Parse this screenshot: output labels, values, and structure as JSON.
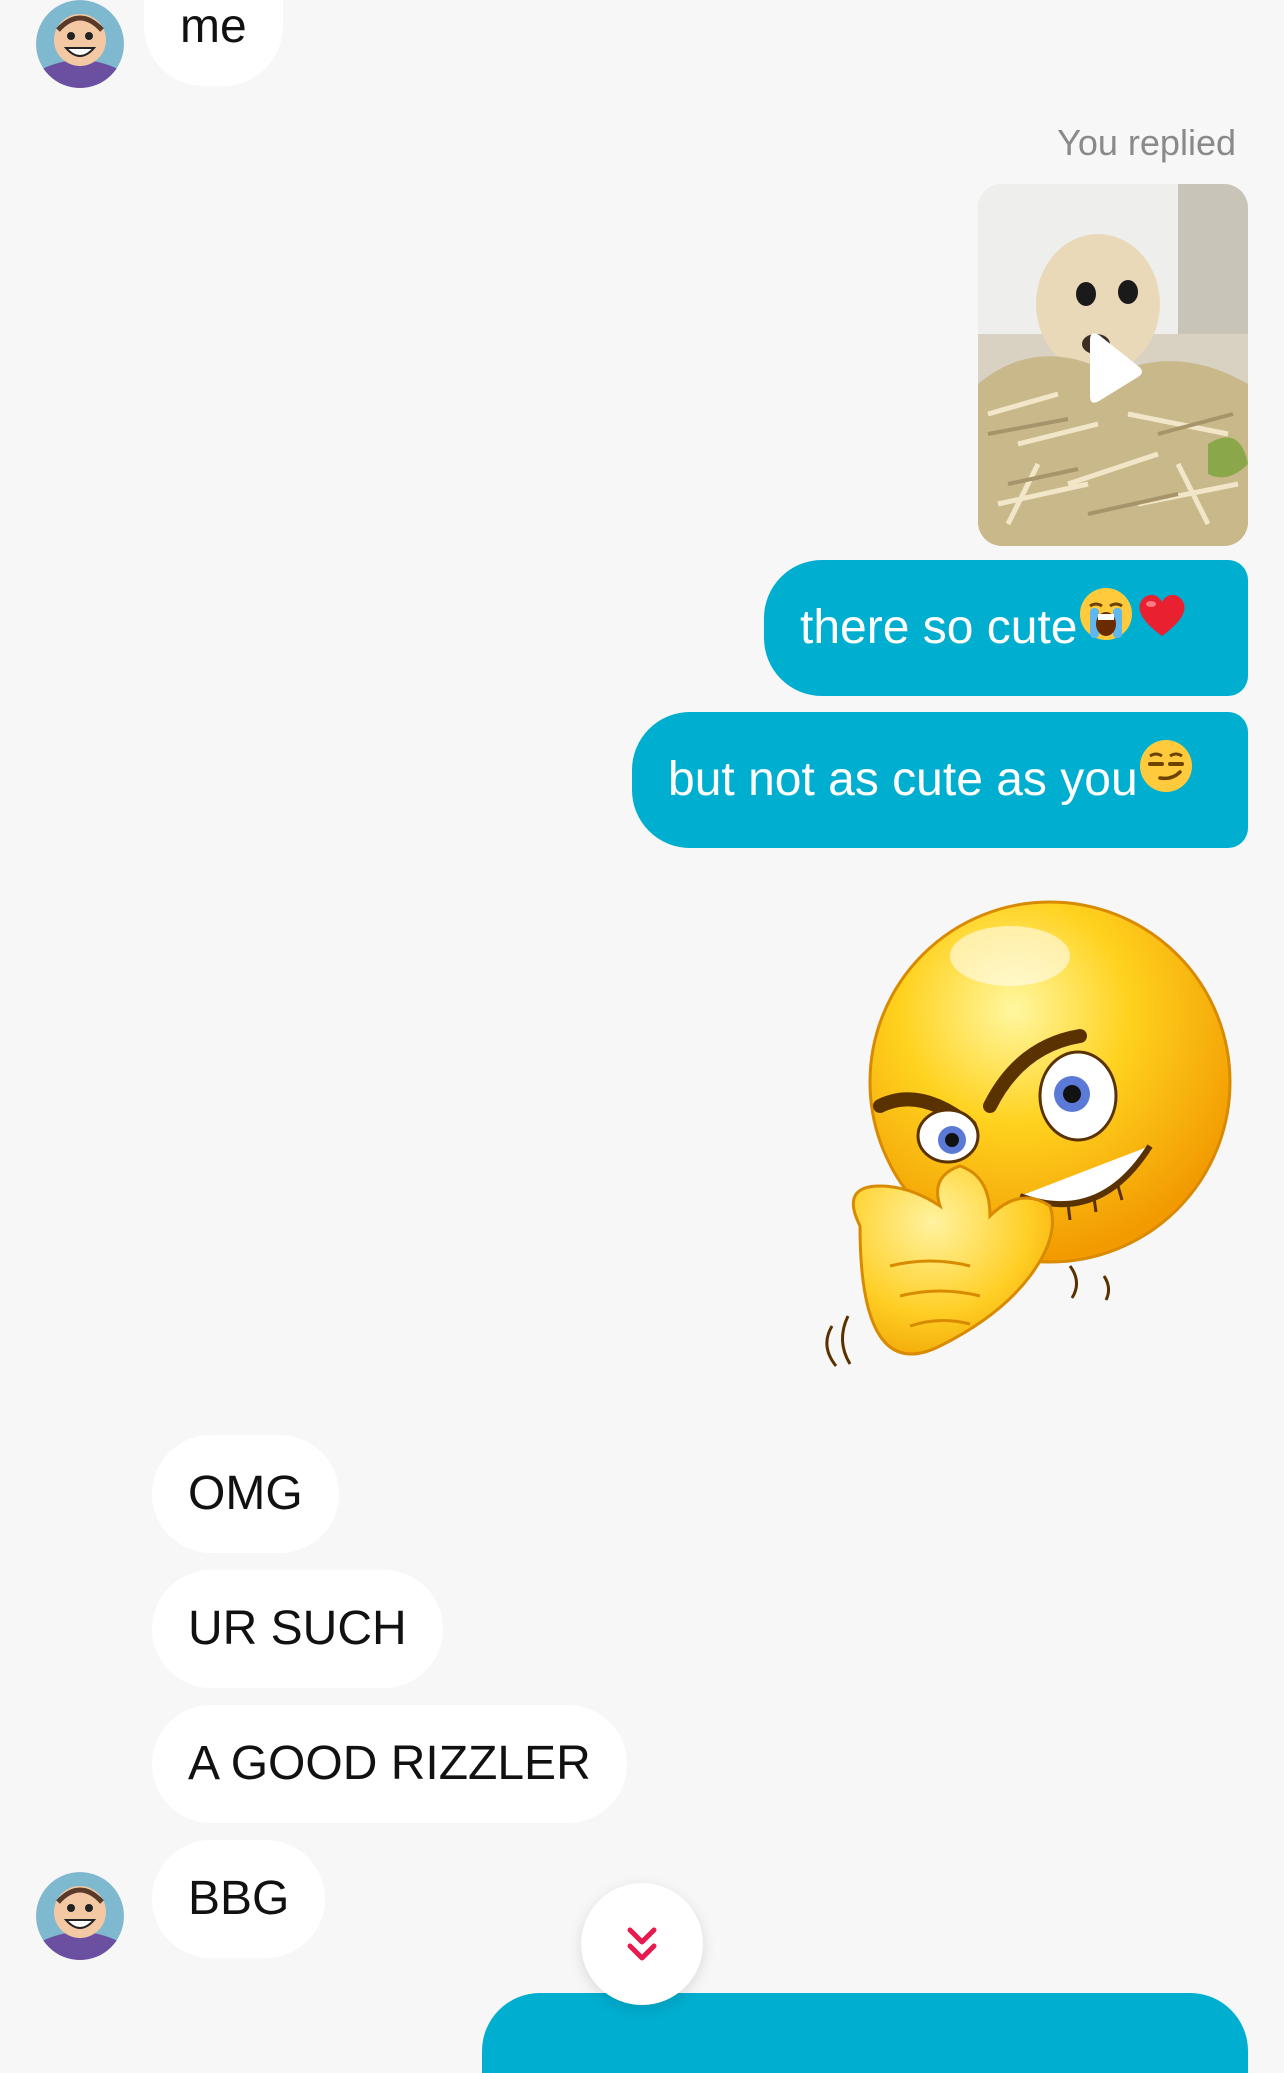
{
  "messages": {
    "top_incoming": "me",
    "you_replied_label": "You replied",
    "outgoing_1": "there so cute",
    "outgoing_2": "but not as cute as you",
    "incoming_1": "OMG",
    "incoming_2": "UR SUCH",
    "incoming_3": "A GOOD RIZZLER",
    "incoming_4": "BBG"
  },
  "icons": {
    "outgoing_1_emojis": [
      "loudly-crying-face-icon",
      "red-heart-icon"
    ],
    "outgoing_2_emoji": "smirking-face-icon",
    "sticker": "smirking-rubbing-hands-emoji-sticker",
    "video_play": "play-icon",
    "scroll_down": "double-chevron-down-icon"
  },
  "colors": {
    "background": "#f7f7f7",
    "outgoing_bubble": "#00aed0",
    "incoming_bubble": "#ffffff",
    "scroll_chevron": "#e8194f"
  }
}
